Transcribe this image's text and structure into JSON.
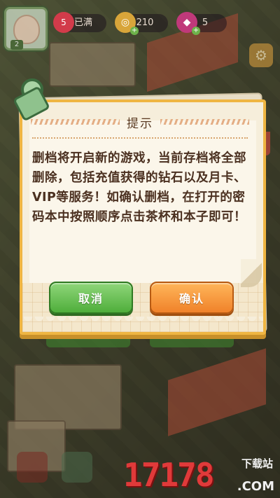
{
  "hud": {
    "level": "5",
    "status": "已满",
    "coins": "210",
    "gems": "5",
    "avatar_level": "2"
  },
  "icons": {
    "heart": "heart-icon",
    "coin": "coin-icon",
    "gem": "gem-icon",
    "settings": "gear-icon",
    "clip": "paper-clip-icon"
  },
  "dialog": {
    "title": "提示",
    "message": "删档将开启新的游戏，当前存档将全部删除，包括充值获得的钻石以及月卡、VIP等服务！如确认删档，在打开的密码本中按照顺序点击茶杯和本子即可！",
    "cancel_label": "取消",
    "confirm_label": "确认"
  },
  "watermark": {
    "digits": "17178",
    "cn": "下载站",
    "com": ".COM"
  },
  "colors": {
    "accent_frame": "#efb542",
    "cancel_button": "#4fae3b",
    "confirm_button": "#f0822a",
    "text": "#4b3020",
    "watermark": "#e03a3a"
  }
}
